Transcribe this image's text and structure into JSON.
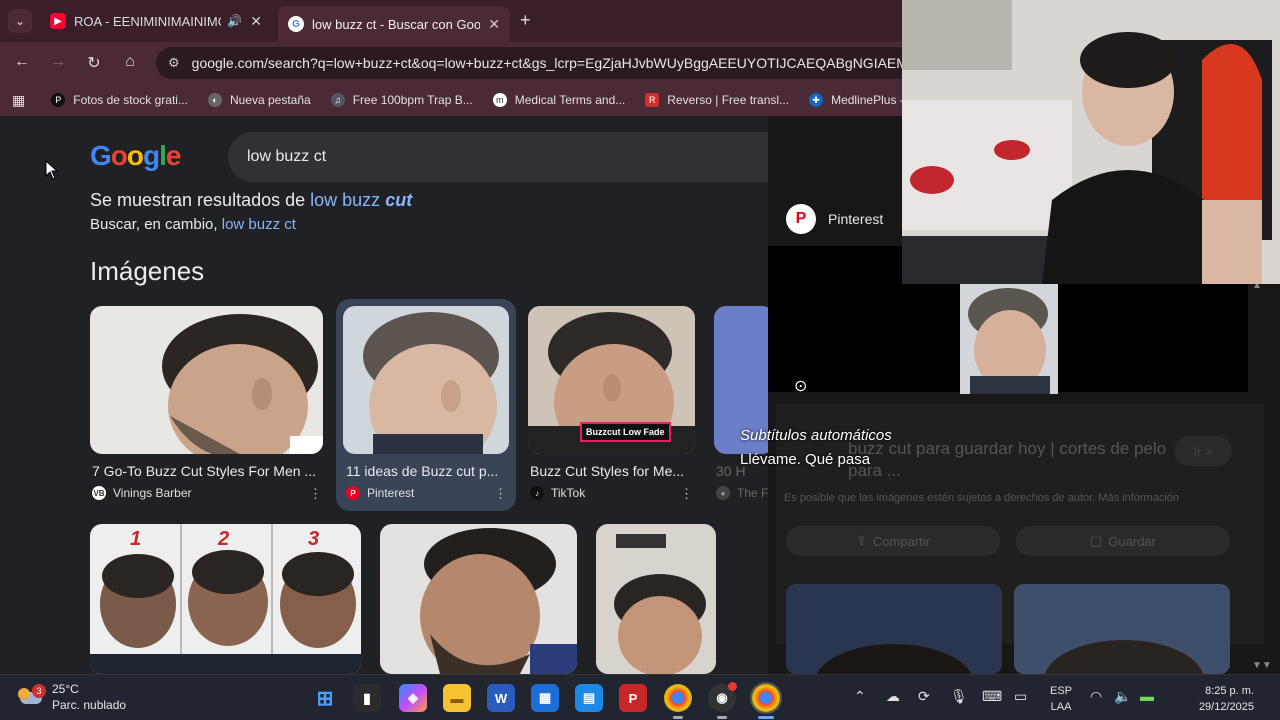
{
  "browser": {
    "tabs": [
      {
        "title": "ROA - EENIMINIMAINIMO",
        "favicon": "youtube-icon",
        "audio": true
      },
      {
        "title": "low buzz ct - Buscar con Google",
        "favicon": "google-icon",
        "active": true
      }
    ],
    "url": "google.com/search?q=low+buzz+ct&oq=low+buzz+ct&gs_lcrp=EgZjaHJvbWUyBggAEEUYOTIJCAEQABgNGIAEMg",
    "bookmarks": [
      {
        "label": "Fotos de stock grati..."
      },
      {
        "label": "Nueva pestaña"
      },
      {
        "label": "Free 100bpm Trap B..."
      },
      {
        "label": "Medical Terms and..."
      },
      {
        "label": "Reverso | Free transl..."
      },
      {
        "label": "MedlinePlus - Inf"
      }
    ]
  },
  "google": {
    "logo": [
      "G",
      "o",
      "o",
      "g",
      "l",
      "e"
    ],
    "query": "low buzz ct",
    "spell": {
      "showing_prefix": "Se muestran resultados de",
      "showing_plain": "low buzz",
      "showing_bold": "cut",
      "instead_prefix": "Buscar, en cambio,",
      "instead_link": "low buzz ct"
    },
    "images_title": "Imágenes",
    "image_results": [
      {
        "caption": "7 Go-To Buzz Cut Styles For Men ...",
        "source": "Vinings Barber"
      },
      {
        "caption": "11 ideas de Buzz cut p...",
        "source": "Pinterest"
      },
      {
        "caption": "Buzz Cut Styles for Me...",
        "source": "TikTok",
        "badge": "Buzzcut Low Fade"
      },
      {
        "caption": "30 H",
        "source": "The F"
      }
    ],
    "row2_numbers": [
      "1",
      "2",
      "3"
    ]
  },
  "panel": {
    "source": "Pinterest",
    "title_faint": "buzz cut para guardar hoy | cortes de pelo para ...",
    "rights_faint": "Es posible que las imágenes estén sujetas a derechos de autor. Más información",
    "share": "Compartir",
    "save": "Guardar",
    "visit": "Ir >"
  },
  "captions": {
    "header": "Subtítulos automáticos",
    "line": "Llévame. Qué pasa"
  },
  "taskbar": {
    "weather_temp": "25°C",
    "weather_desc": "Parc. nublado",
    "weather_badge": "3",
    "lang1": "ESP",
    "lang2": "LAA",
    "time": "8:25 p. m.",
    "date": "29/12/2025"
  },
  "colors": {
    "tabstrip": "#3a1f2a",
    "toolbar": "#4b2a38",
    "page_bg": "#202124",
    "link": "#8ab4f8",
    "selected_card": "#394457"
  }
}
